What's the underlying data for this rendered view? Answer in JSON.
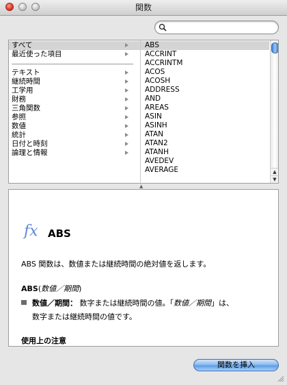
{
  "window": {
    "title": "関数"
  },
  "search": {
    "placeholder": "",
    "value": ""
  },
  "categories": [
    {
      "label": "すべて"
    },
    {
      "label": "最近使った項目"
    },
    {
      "label": "テキスト"
    },
    {
      "label": "継続時間"
    },
    {
      "label": "工学用"
    },
    {
      "label": "財務"
    },
    {
      "label": "三角関数"
    },
    {
      "label": "参照"
    },
    {
      "label": "数値"
    },
    {
      "label": "統計"
    },
    {
      "label": "日付と時刻"
    },
    {
      "label": "論理と情報"
    }
  ],
  "functions": [
    "ABS",
    "ACCRINT",
    "ACCRINTM",
    "ACOS",
    "ACOSH",
    "ADDRESS",
    "AND",
    "AREAS",
    "ASIN",
    "ASINH",
    "ATAN",
    "ATAN2",
    "ATANH",
    "AVEDEV",
    "AVERAGE"
  ],
  "description": {
    "fx": "fx",
    "name": "ABS",
    "summary": "ABS 関数は、数値または継続時間の絶対値を返します。",
    "syntax_fn": "ABS",
    "syntax_open": "(",
    "syntax_arg": "数値／期間",
    "syntax_close": ")",
    "param_name": "数値／期間：",
    "param_text_a": "  数字または継続時間の値。「",
    "param_arg": "数値／期間",
    "param_text_b": "」は、",
    "param_line2": "数字または継続時間の値です。",
    "usage_heading": "使用上の注意"
  },
  "buttons": {
    "insert": "関数を挿入"
  }
}
